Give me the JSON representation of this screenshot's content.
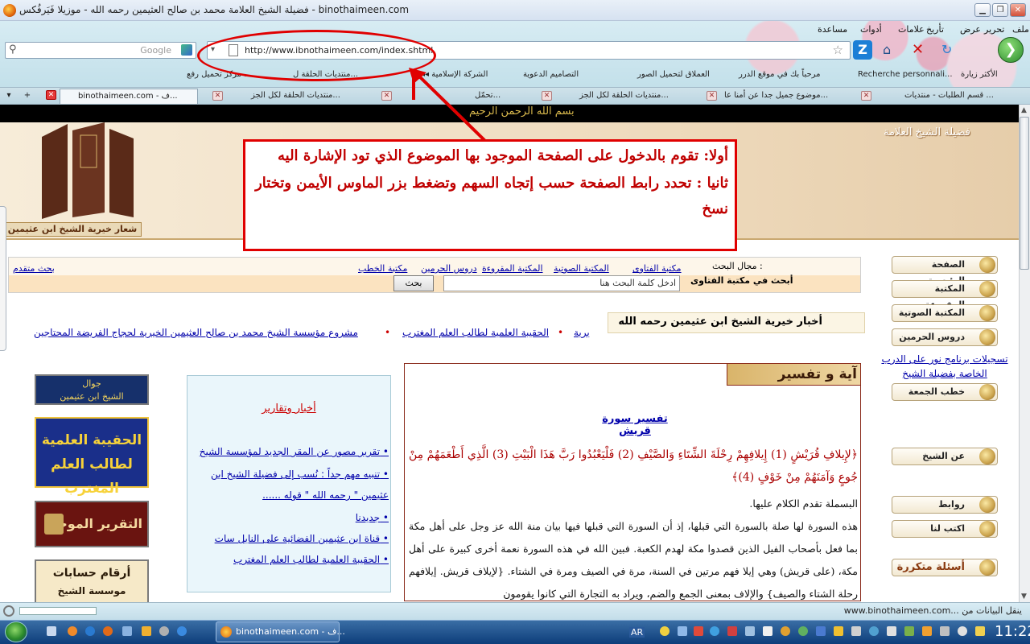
{
  "window": {
    "title": "فضيلة الشيخ العلامة محمد بن صالح العثيمين رحمه الله - موزيلا فَيَرفُكس - binothaimeen.com",
    "minimize": "▁",
    "restore": "❐",
    "close": "✕"
  },
  "menu": {
    "file": "ملف",
    "edit": "تحرير",
    "view": "عرض",
    "history": "تأريخ",
    "bookmarks": "علامات",
    "tools": "أدوات",
    "help": "مساعدة"
  },
  "search": {
    "engine_placeholder": "Google"
  },
  "address": {
    "url": "http://www.ibnothaimeen.com/index.shtml"
  },
  "bookmarks": [
    "الأكثر زيارة",
    "Recherche personnali...",
    "مرحباً بك في موقع الدرر",
    "العملاق لتحميل الصور",
    "التصاميم الدعوية",
    "◂◂ الشركة الإسلامية",
    "منتديات الحلقة ل...",
    "مركز تحميل رفع ..."
  ],
  "tabs": [
    {
      "label": "قسم الطلبات - منتديات ..."
    },
    {
      "label": "موضوع جميل جدا عن أمنا عا..."
    },
    {
      "label": "منتديات الحلقة لكل الجز..."
    },
    {
      "label": "تحمّل..."
    },
    {
      "label": "منتديات الحلقة لكل الجز..."
    },
    {
      "label": "binothaimeen.com - ف..."
    }
  ],
  "page": {
    "basmala": "بسم الله الرحمن الرحيم",
    "site_logo": "فضيلة الشيخ العلامة",
    "emblem_label": "شعار خيرية الشيخ ابن عثيمين",
    "callout_line1": "أولا: تقوم بالدخول على الصفحة الموجود بها الموضوع الذي تود الإشارة اليه",
    "callout_line2": "ثانيا : تحدد رابط الصفحة حسب إتجاه السهم وتضغط بزر الماوس الأيمن وتختار نسخ",
    "search_field_label": "مجال البحث :",
    "search_links": [
      "مكتبة الفتاوى",
      "المكتبة الصوتية",
      "المكتبة المقروءة",
      "دروس الحرمين",
      "مكتبة الخطب"
    ],
    "advanced_search": "بحث متقدم",
    "search_in_label": "أبحث في مكتبة الفتاوى",
    "search_input_value": "ادخل كلمة البحث هنا",
    "search_button": "بحث",
    "news_heading": "أخبار خيرية الشيخ ابن عثيمين رحمه الله",
    "ticker": [
      "يرية",
      "الحقيبة العلمية لطالب العلم المغترب",
      "مشروع مؤسسة الشيخ محمد بن صالح العثيمين الخيرية لحجاج الفريضة المحتاجين"
    ],
    "right_nav": [
      "الصفحة الرئيسية",
      "المكتبة المقروءة",
      "المكتبة الصوتية",
      "دروس الحرمين",
      "خطب الجمعة",
      "عن الشيخ",
      "روابط",
      "اكتب لنا",
      "أسئلة متكررة"
    ],
    "noor_link": "تسجيلات برنامج نور على الدرب الخاصة بفضيلة الشيخ",
    "aya_header": "آية و تفسير",
    "aya_title": "تفسير سورة قريش",
    "aya_verse": "﴿لإِيلافِ قُرَيْشٍ (1) إِيلافِهِمْ رِحْلَةَ الشِّتَاءِ وَالصَّيْفِ (2) فَلْيَعْبُدُوا رَبَّ هَذَا الْبَيْتِ (3) الَّذِي أَطْعَمَهُمْ مِنْ جُوعٍ وَآمَنَهُمْ مِنْ خَوْفٍ (4)﴾",
    "aya_body_1": "البسملة تقدم الكلام عليها.",
    "aya_body_2": "هذه السورة لها صلة بالسورة التي قبلها، إذ أن السورة التي قبلها فيها بيان منة الله عز وجل على أهل مكة بما فعل بأصحاب الفيل الذين قصدوا مكة لهدم الكعبة. فبين الله في هذه السورة نعمة أخرى كبيرة على أهل مكة، (على قريش) وهي إيلا فهم مرتين في السنة، مرة في الصيف ومرة في الشتاء. {لإيلاف قريش. إيلافهم رحلة الشتاء والصيف} والإلاف بمعنى الجمع والضم، ويراد به التجارة التي كانوا يقومون",
    "newsbox_title": "أخبار وتقارير",
    "newsbox_items": [
      "تقرير مصور عن المقر الجديد لمؤسسة الشيخ",
      "تنبيه مهم جداً : نُسب إلى فضيلة الشيخ ابن عثيمين \" رحمه الله \" قوله ......",
      "جديدنا",
      "قناة ابن عثيمين الفضائية على النايل سات",
      "الحقيبة العلمية لطالب العلم المغترب"
    ],
    "banner1_l1": "جوال",
    "banner1_l2": "الشيخ ابن عثيمين",
    "banner2_l1": "الحقيبة العلمية",
    "banner2_l2": "لطالب العلم المغترب",
    "banner3": "التقرير الموجز",
    "banner4_l1": "أرقام حسابات",
    "banner4_l2": "موسسة الشيخ"
  },
  "status": {
    "text": "www.binothaimeen.com... ينقل البيانات من"
  },
  "taskbar": {
    "item": "binothaimeen.com - ف...",
    "lang": "AR",
    "clock": "11:22"
  },
  "colors": {
    "accent_red": "#e00000",
    "link_blue": "#0000aa"
  }
}
